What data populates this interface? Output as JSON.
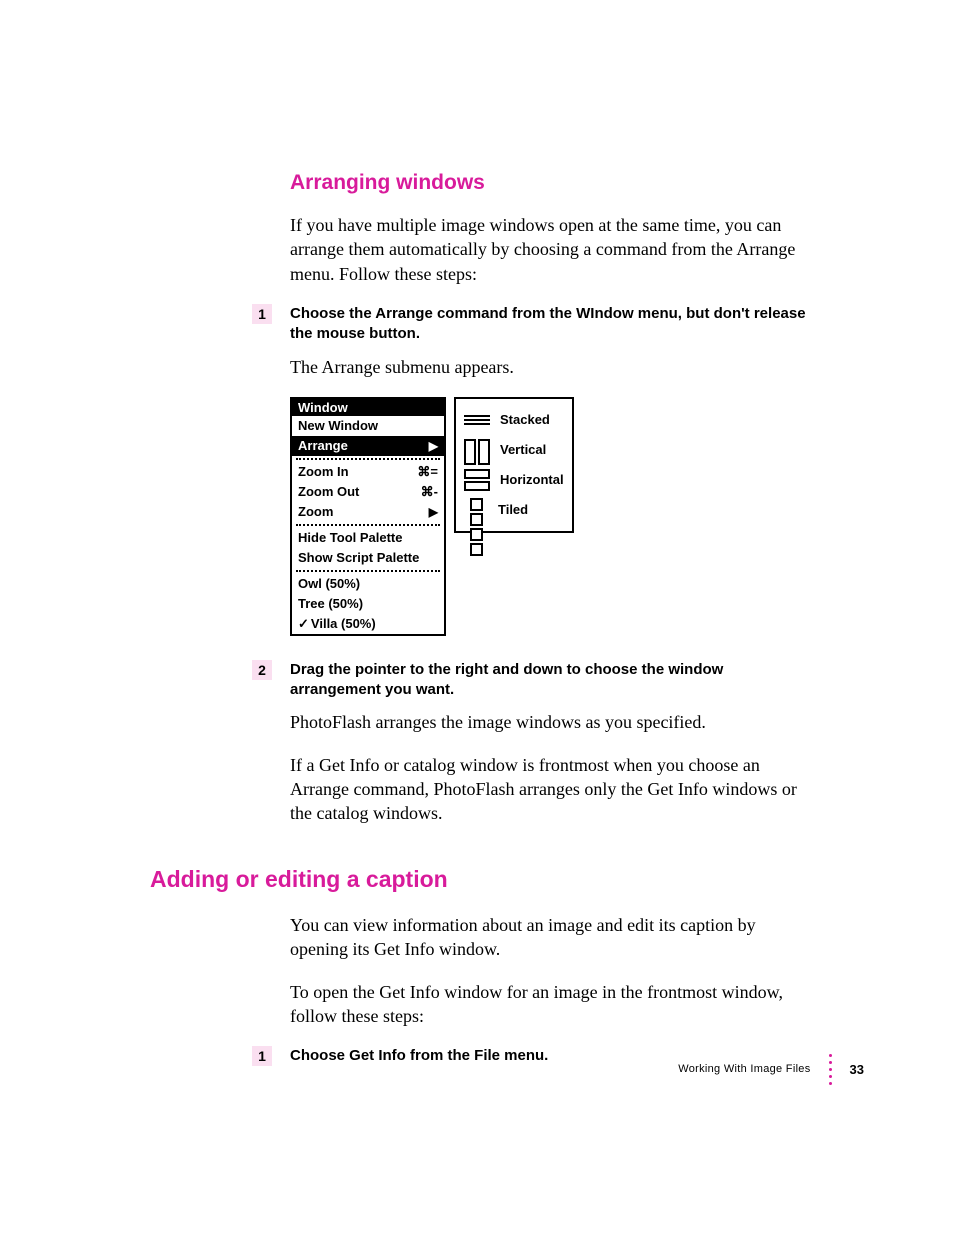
{
  "section1": {
    "heading": "Arranging windows",
    "intro": "If you have multiple image windows open at the same time, you can arrange them automatically by choosing a command from the Arrange menu. Follow these steps:",
    "step1": {
      "num": "1",
      "text": "Choose the Arrange command from the WIndow menu, but don't release the mouse button."
    },
    "after1": "The Arrange submenu appears.",
    "menu": {
      "title": "Window",
      "items": [
        {
          "label": "New Window"
        },
        {
          "label": "Arrange",
          "selected": true,
          "arrow": "▶"
        },
        {
          "divider": true
        },
        {
          "label": "Zoom In",
          "key": "⌘="
        },
        {
          "label": "Zoom Out",
          "key": "⌘-"
        },
        {
          "label": "Zoom",
          "arrow": "▶"
        },
        {
          "divider": true
        },
        {
          "label": "Hide Tool Palette"
        },
        {
          "label": "Show Script Palette"
        },
        {
          "divider": true
        },
        {
          "label": "Owl (50%)"
        },
        {
          "label": "Tree (50%)"
        },
        {
          "label": "Villa (50%)",
          "checked": true
        }
      ],
      "submenu": [
        "Stacked",
        "Vertical",
        "Horizontal",
        "Tiled"
      ]
    },
    "step2": {
      "num": "2",
      "text": "Drag the pointer to the right and down to choose the window arrangement you want."
    },
    "after2a": "PhotoFlash arranges the image windows as you specified.",
    "after2b": "If a Get Info or catalog window is frontmost when you choose an Arrange command, PhotoFlash arranges only the Get Info windows or the catalog windows."
  },
  "section2": {
    "heading": "Adding or editing a caption",
    "p1": "You can view information about an image and edit its caption by opening its Get Info window.",
    "p2": "To open the Get Info window for an image in the frontmost window, follow these steps:",
    "step1": {
      "num": "1",
      "text": "Choose Get Info from the File menu."
    }
  },
  "footer": {
    "title": "Working With Image Files",
    "page": "33"
  }
}
